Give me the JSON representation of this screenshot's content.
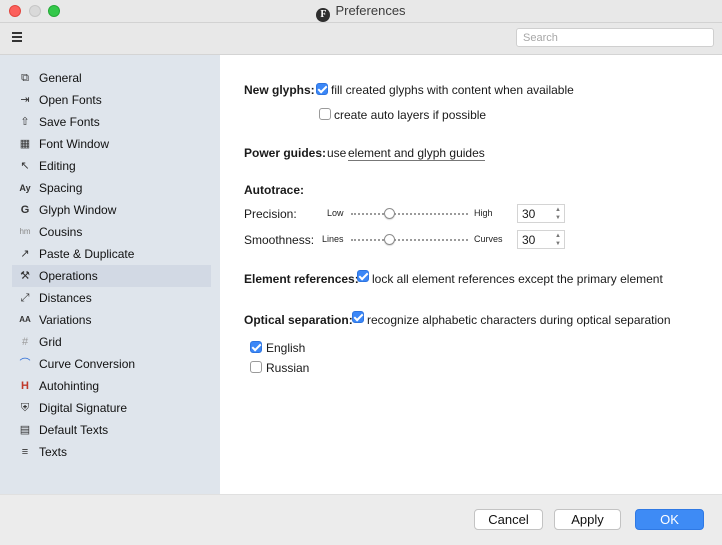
{
  "window": {
    "title": "Preferences",
    "app_icon_letter": "F"
  },
  "toolbar": {
    "search_placeholder": "Search"
  },
  "sidebar": {
    "items": [
      {
        "label": "General",
        "icon": "general-icon",
        "glyph": "⧉"
      },
      {
        "label": "Open Fonts",
        "icon": "open-fonts-icon",
        "glyph": "⇥"
      },
      {
        "label": "Save Fonts",
        "icon": "save-fonts-icon",
        "glyph": "⇧"
      },
      {
        "label": "Font Window",
        "icon": "font-window-icon",
        "glyph": "▦"
      },
      {
        "label": "Editing",
        "icon": "editing-icon",
        "glyph": "↖"
      },
      {
        "label": "Spacing",
        "icon": "spacing-icon",
        "glyph": "Ay"
      },
      {
        "label": "Glyph Window",
        "icon": "glyph-window-icon",
        "glyph": "G"
      },
      {
        "label": "Cousins",
        "icon": "cousins-icon",
        "glyph": "hm"
      },
      {
        "label": "Paste & Duplicate",
        "icon": "paste-duplicate-icon",
        "glyph": "↗"
      },
      {
        "label": "Operations",
        "icon": "wrench-icon",
        "glyph": "⚒"
      },
      {
        "label": "Distances",
        "icon": "distances-icon",
        "glyph": "⤢"
      },
      {
        "label": "Variations",
        "icon": "variations-icon",
        "glyph": "AA"
      },
      {
        "label": "Grid",
        "icon": "grid-icon",
        "glyph": "#"
      },
      {
        "label": "Curve Conversion",
        "icon": "curve-icon",
        "glyph": "⌒"
      },
      {
        "label": "Autohinting",
        "icon": "autohinting-icon",
        "glyph": "H"
      },
      {
        "label": "Digital Signature",
        "icon": "shield-icon",
        "glyph": "⛨"
      },
      {
        "label": "Default Texts",
        "icon": "default-texts-icon",
        "glyph": "▤"
      },
      {
        "label": "Texts",
        "icon": "texts-icon",
        "glyph": "≡"
      }
    ],
    "selected": "Operations"
  },
  "main": {
    "new_glyphs": {
      "label": "New glyphs:",
      "fill_option": {
        "text": "fill created glyphs with content when available",
        "checked": true
      },
      "auto_layers_option": {
        "text": "create auto layers if possible",
        "checked": false
      }
    },
    "power_guides": {
      "label": "Power guides:",
      "prefix": "use",
      "link": "element and glyph guides"
    },
    "autotrace": {
      "label": "Autotrace:",
      "precision": {
        "label": "Precision:",
        "min_label": "Low",
        "max_label": "High",
        "value": "30",
        "slider_fraction": 0.33
      },
      "smoothness": {
        "label": "Smoothness:",
        "min_label": "Lines",
        "max_label": "Curves",
        "value": "30",
        "slider_fraction": 0.33
      }
    },
    "element_references": {
      "label": "Element references:",
      "text": "lock all element references except the primary element",
      "checked": true
    },
    "optical_separation": {
      "label": "Optical separation:",
      "text": "recognize alphabetic characters during optical separation",
      "checked": true,
      "languages": [
        {
          "label": "English",
          "checked": true
        },
        {
          "label": "Russian",
          "checked": false
        }
      ]
    }
  },
  "footer": {
    "cancel": "Cancel",
    "apply": "Apply",
    "ok": "OK"
  },
  "colors": {
    "accent": "#3e8bf5",
    "sidebar": "#dfe5ec",
    "selection": "#d2d9e4"
  }
}
